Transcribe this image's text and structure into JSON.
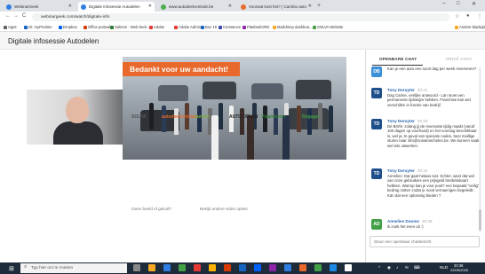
{
  "browser": {
    "tabs": [
      {
        "label": "WebinarGeek",
        "active": false,
        "color": "#2f7de1"
      },
      {
        "label": "Digitale infosessie Autodelen",
        "active": true,
        "color": "#2f7de1"
      },
      {
        "label": "www.autodeelcentrale.be",
        "active": false,
        "color": "#4caf50"
      },
      {
        "label": "Voorwat kost het? | Cambio auto",
        "active": false,
        "color": "#e86c2b"
      }
    ],
    "new_tab": "+",
    "window_controls": [
      "–",
      "□",
      "✕"
    ],
    "url": "webinargeek.com/watch/digitale-info",
    "nav": {
      "back": "←",
      "forward": "→",
      "reload": "C"
    },
    "bookmarks": [
      {
        "label": "Apps",
        "color": "#5f6368"
      },
      {
        "label": "Dr. myProtime",
        "color": "#1565c0"
      },
      {
        "label": "Dropbox",
        "color": "#0061fe"
      },
      {
        "label": "Office portaal",
        "color": "#d83b01"
      },
      {
        "label": "Salmon - Web beck...",
        "color": "#2e7d32"
      },
      {
        "label": "Adobe",
        "color": "#e53935"
      },
      {
        "label": "Adobe Admin",
        "color": "#e53935"
      },
      {
        "label": "Box 15",
        "color": "#1565c0"
      },
      {
        "label": "Cressence",
        "color": "#3949ab"
      },
      {
        "label": "PlanbedCRM",
        "color": "#8e24aa"
      },
      {
        "label": "Mailchimp dashboa...",
        "color": "#f9a825"
      },
      {
        "label": "SOLVA Website",
        "color": "#43a047"
      },
      {
        "label": "Andere bladwijzers",
        "color": "#f9a825"
      }
    ]
  },
  "page": {
    "title": "Digitale infosessie Autodelen"
  },
  "slide": {
    "banner": "Bedankt voor uw aandacht!",
    "logos": [
      {
        "text": "SOLVA",
        "color": "#555555"
      },
      {
        "text": "autodeelcentrale",
        "color": "#e8692b"
      },
      {
        "text": "cambio",
        "color": "#7cb342"
      },
      {
        "text": "AUTO DELEN",
        "color": "#222222"
      },
      {
        "text": "Vlaanderen",
        "color": "#2e7d32"
      },
      {
        "text": "Dégage!",
        "color": "#43a047"
      }
    ]
  },
  "controls": {
    "left": "Geen beeld of geluid?",
    "right": "Bekijk andere video opties"
  },
  "chat": {
    "tab_open": "OPENBARE CHAT",
    "tab_private": "PRIVÉ CHAT",
    "messages": [
      {
        "initials": "DB",
        "color": "#3b8fd9",
        "name": "",
        "time": "",
        "text": "Kan je een auto een soort dag per week reserveren?"
      },
      {
        "initials": "TD",
        "color": "#1f4f8b",
        "name": "Tony Deruyter",
        "time": "20:31",
        "text": "Dag Carine, eerlijke antwoord - Lan moet een permanente tijdswijze hebben. Franchise kan wel verschillen in functie van bedrijf."
      },
      {
        "initials": "TD",
        "color": "#1f4f8b",
        "name": "Tony Deruyter",
        "time": "20:33",
        "text": "Dé Börfe: zolang jij de reservatie tijdig maakt (vanaf 100 dagen op voorhand) en het voertuig beschikbaar is, wel ja. In geval van speciale noden, best maillige sturen naar info@solvamechelen.be. We kunnen vaak wel iets uitwerken."
      },
      {
        "initials": "TD",
        "color": "#1f4f8b",
        "name": "Tony Deruyter",
        "time": "20:34",
        "text": "Annelies: Dat gaat helaas niet. Echter, weet dat wel van onze gebruikers een prijsgeld bredebekaart hebben. Warrop kan je voor pool? een bepaald \"veilig\" bedrag zetten zodat je nooit vernaenigen begeleidt. Kan dat een oplossing bieden ?"
      },
      {
        "initials": "AD",
        "color": "#43a047",
        "name": "Annelies Dooms",
        "time": "20:35",
        "text": "ik zoek het even uit :)"
      }
    ],
    "input_placeholder": "Stuur een openbaar chatbericht"
  },
  "taskbar": {
    "search_placeholder": "Typ hier om te zoeken",
    "time": "20:36",
    "date": "22/05/2020",
    "lang": "NLD"
  }
}
